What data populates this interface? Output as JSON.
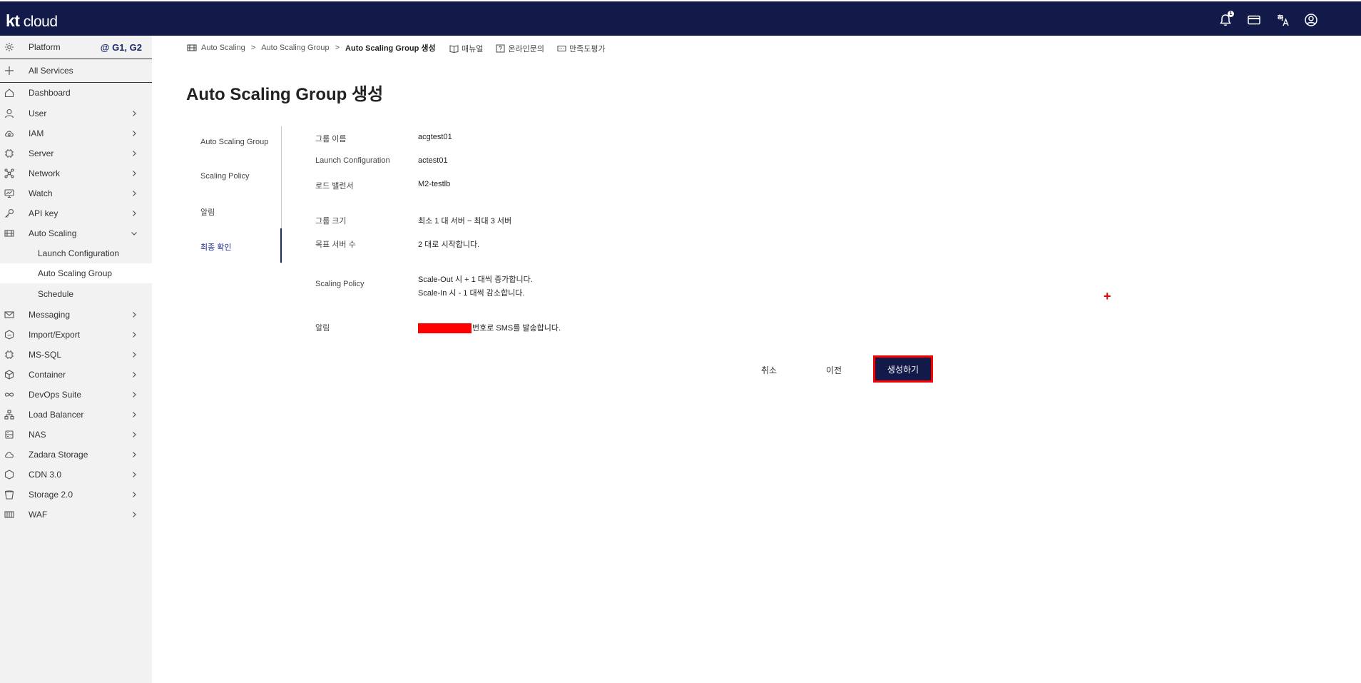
{
  "header": {
    "logo_kt": "kt",
    "logo_cloud": "cloud",
    "icons": [
      "bell-icon",
      "card-icon",
      "language-icon",
      "user-icon"
    ],
    "notification_count": "1"
  },
  "sidebar": {
    "platform_label": "Platform",
    "platform_badge": "@ G1, G2",
    "all_services": "All Services",
    "items": [
      {
        "label": "Dashboard",
        "icon": "home-icon"
      },
      {
        "label": "User",
        "icon": "user-icon"
      },
      {
        "label": "IAM",
        "icon": "cloud-icon"
      },
      {
        "label": "Server",
        "icon": "server-icon"
      },
      {
        "label": "Network",
        "icon": "network-icon"
      },
      {
        "label": "Watch",
        "icon": "monitor-icon"
      },
      {
        "label": "API key",
        "icon": "key-icon"
      },
      {
        "label": "Auto Scaling",
        "icon": "autoscaling-icon"
      },
      {
        "label": "Launch Configuration"
      },
      {
        "label": "Auto Scaling Group"
      },
      {
        "label": "Schedule"
      },
      {
        "label": "Messaging",
        "icon": "mail-icon"
      },
      {
        "label": "Import/Export",
        "icon": "import-export-icon"
      },
      {
        "label": "MS-SQL",
        "icon": "database-icon"
      },
      {
        "label": "Container",
        "icon": "container-icon"
      },
      {
        "label": "DevOps Suite",
        "icon": "infinity-icon"
      },
      {
        "label": "Load Balancer",
        "icon": "load-balancer-icon"
      },
      {
        "label": "NAS",
        "icon": "nas-icon"
      },
      {
        "label": "Zadara Storage",
        "icon": "storage-cloud-icon"
      },
      {
        "label": "CDN 3.0",
        "icon": "cdn-icon"
      },
      {
        "label": "Storage 2.0",
        "icon": "bucket-icon"
      },
      {
        "label": "WAF",
        "icon": "waf-icon"
      }
    ]
  },
  "breadcrumb": {
    "items": [
      "Auto Scaling",
      "Auto Scaling Group",
      "Auto Scaling Group 생성"
    ],
    "separator": ">"
  },
  "links": {
    "manual": "매뉴얼",
    "inquiry": "온라인문의",
    "survey": "만족도평가"
  },
  "page": {
    "title": "Auto Scaling Group 생성"
  },
  "steps": [
    "Auto Scaling Group",
    "Scaling Policy",
    "알림",
    "최종 확인"
  ],
  "summary": {
    "group_name_label": "그룹 이름",
    "group_name": "acgtest01",
    "launch_config_label": "Launch Configuration",
    "launch_config": "actest01",
    "lb_label": "로드 밸런서",
    "lb": "M2-testlb",
    "size_label": "그룹 크기",
    "size": "최소 1 대 서버 ~ 최대 3 서버",
    "target_label": "목표 서버 수",
    "target": "2 대로 시작합니다.",
    "policy_label": "Scaling Policy",
    "policy_out": "Scale-Out 시 + 1 대씩 증가합니다.",
    "policy_in": "Scale-In 시 - 1 대씩 감소합니다.",
    "alarm_label": "알림",
    "alarm": "번호로 SMS를 발송합니다."
  },
  "buttons": {
    "cancel": "취소",
    "prev": "이전",
    "create": "생성하기"
  },
  "annotation": {
    "plus": "+"
  },
  "colors": {
    "header_bg": "#121a4a",
    "accent": "#1a2b6b",
    "highlight": "#ff0000"
  }
}
